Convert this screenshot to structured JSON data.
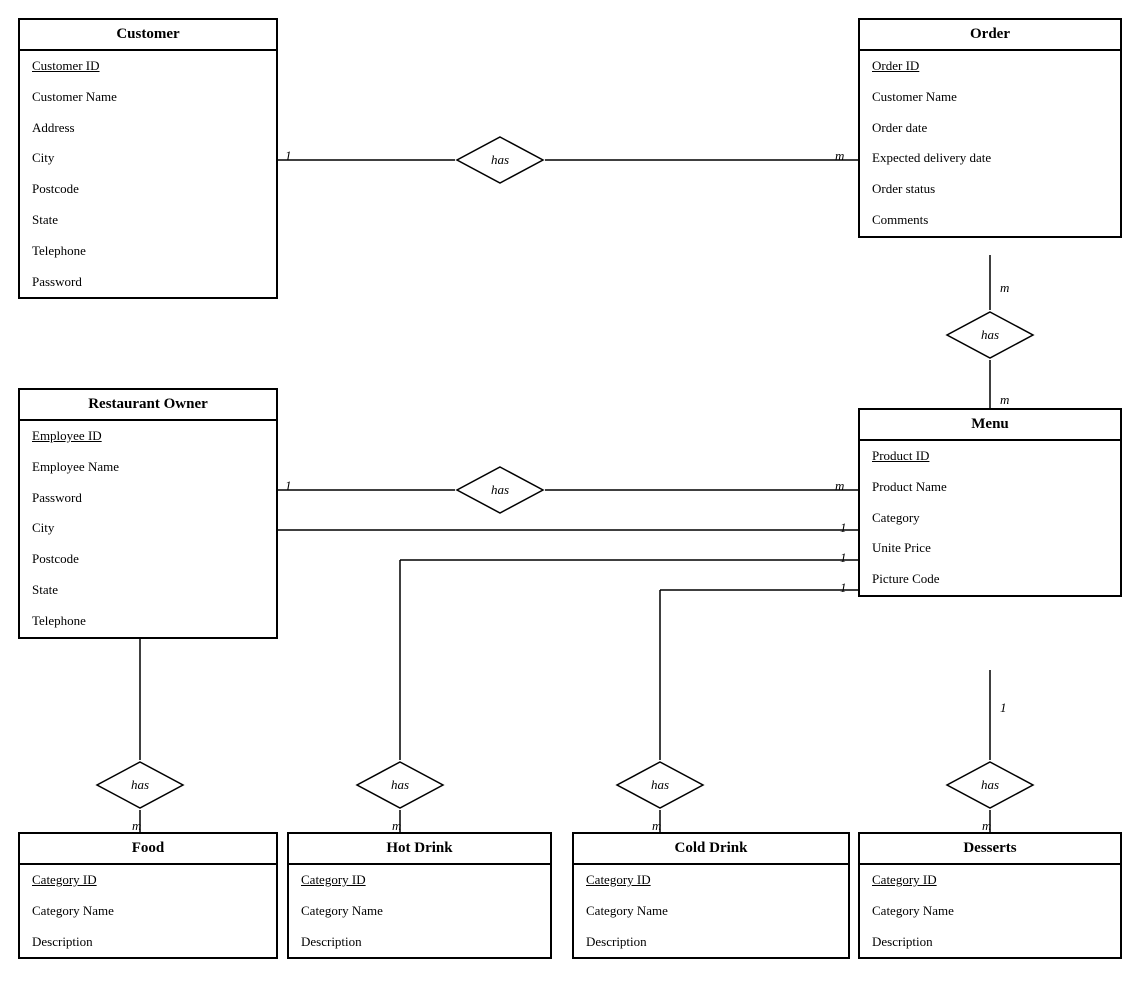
{
  "entities": {
    "customer": {
      "title": "Customer",
      "attrs": [
        {
          "text": "Customer ID",
          "pk": true
        },
        {
          "text": "Customer Name",
          "pk": false
        },
        {
          "text": "Address",
          "pk": false
        },
        {
          "text": "City",
          "pk": false
        },
        {
          "text": "Postcode",
          "pk": false
        },
        {
          "text": "State",
          "pk": false
        },
        {
          "text": "Telephone",
          "pk": false
        },
        {
          "text": "Password",
          "pk": false
        }
      ]
    },
    "order": {
      "title": "Order",
      "attrs": [
        {
          "text": "Order ID",
          "pk": true
        },
        {
          "text": "Customer Name",
          "pk": false
        },
        {
          "text": "Order date",
          "pk": false
        },
        {
          "text": "Expected delivery date",
          "pk": false
        },
        {
          "text": "Order status",
          "pk": false
        },
        {
          "text": "Comments",
          "pk": false
        }
      ]
    },
    "restaurantOwner": {
      "title": "Restaurant Owner",
      "attrs": [
        {
          "text": "Employee ID",
          "pk": true
        },
        {
          "text": "Employee Name",
          "pk": false
        },
        {
          "text": "Password",
          "pk": false
        },
        {
          "text": "City",
          "pk": false
        },
        {
          "text": "Postcode",
          "pk": false
        },
        {
          "text": "State",
          "pk": false
        },
        {
          "text": "Telephone",
          "pk": false
        }
      ]
    },
    "menu": {
      "title": "Menu",
      "attrs": [
        {
          "text": "Product ID",
          "pk": true
        },
        {
          "text": "Product Name",
          "pk": false
        },
        {
          "text": "Category",
          "pk": false
        },
        {
          "text": "Unite Price",
          "pk": false
        },
        {
          "text": "Picture Code",
          "pk": false
        }
      ]
    },
    "food": {
      "title": "Food",
      "attrs": [
        {
          "text": "Category ID",
          "pk": true
        },
        {
          "text": "Category Name",
          "pk": false
        },
        {
          "text": "Description",
          "pk": false
        }
      ]
    },
    "hotDrink": {
      "title": "Hot Drink",
      "attrs": [
        {
          "text": "Category ID",
          "pk": true
        },
        {
          "text": "Category Name",
          "pk": false
        },
        {
          "text": "Description",
          "pk": false
        }
      ]
    },
    "coldDrink": {
      "title": "Cold Drink",
      "attrs": [
        {
          "text": "Category ID",
          "pk": true
        },
        {
          "text": "Category Name",
          "pk": false
        },
        {
          "text": "Description",
          "pk": false
        }
      ]
    },
    "desserts": {
      "title": "Desserts",
      "attrs": [
        {
          "text": "Category ID",
          "pk": true
        },
        {
          "text": "Category Name",
          "pk": false
        },
        {
          "text": "Description",
          "pk": false
        }
      ]
    }
  },
  "relationships": {
    "customerHasOrder": "has",
    "orderHasMenu": "has",
    "ownerHasMenu": "has",
    "ownerHasFood": "has",
    "menuHasHotDrink": "has",
    "menuHasColdDrink": "has",
    "menuHasDesserts": "has"
  },
  "cardinalities": {
    "c1": "1",
    "cm": "m",
    "o1": "m",
    "om": "m",
    "r1": "1",
    "rm": "m",
    "f1": "1",
    "fm": "m"
  }
}
